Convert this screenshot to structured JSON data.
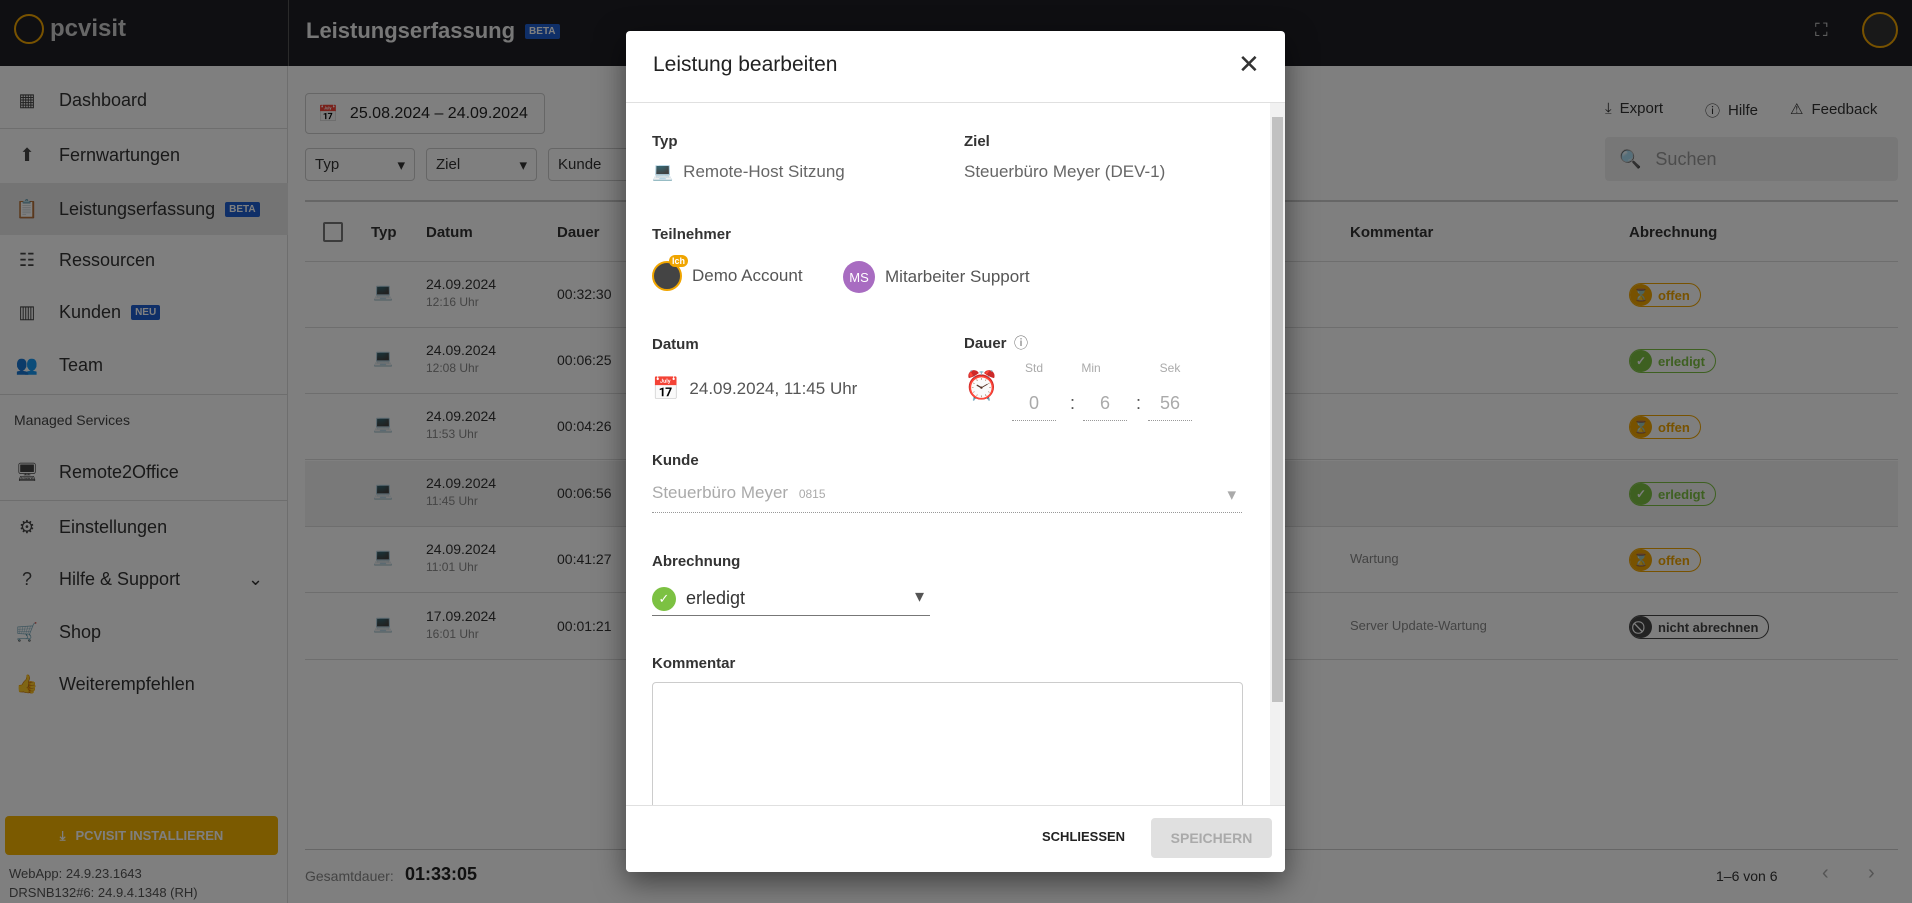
{
  "app": {
    "logo": "pcvisit",
    "title": "Leistungserfassung",
    "title_badge": "BETA"
  },
  "sidebar": {
    "items": [
      {
        "label": "Dashboard",
        "icon": "dashboard-icon"
      },
      {
        "label": "Fernwartungen",
        "icon": "remote-icon"
      },
      {
        "label": "Leistungserfassung",
        "icon": "clipboard-clock-icon",
        "badge": "BETA",
        "active": true
      },
      {
        "label": "Ressourcen",
        "icon": "tree-icon"
      },
      {
        "label": "Kunden",
        "icon": "building-icon",
        "badge": "NEU"
      },
      {
        "label": "Team",
        "icon": "people-icon"
      }
    ],
    "section": "Managed Services",
    "items2": [
      {
        "label": "Remote2Office",
        "icon": "monitor-icon"
      },
      {
        "label": "Einstellungen",
        "icon": "gear-icon"
      },
      {
        "label": "Hilfe & Support",
        "icon": "help-icon"
      },
      {
        "label": "Shop",
        "icon": "cart-icon"
      },
      {
        "label": "Weiterempfehlen",
        "icon": "thumb-up-icon"
      }
    ],
    "install_label": "PCVISIT INSTALLIEREN",
    "versions": [
      "WebApp: 24.9.23.1643",
      "DRSNB132#6: 24.9.4.1348 (RH)"
    ]
  },
  "main": {
    "date_range": "25.08.2024 – 24.09.2024",
    "filters": [
      "Typ",
      "Ziel",
      "Kunde"
    ],
    "toolbar": {
      "export": "Export",
      "help": "Hilfe",
      "feedback": "Feedback"
    },
    "search_placeholder": "Suchen",
    "columns": [
      "Typ",
      "Datum",
      "Dauer",
      "Kommentar",
      "Abrechnung"
    ],
    "rows": [
      {
        "date": "24.09.2024",
        "time": "12:16 Uhr",
        "duration": "00:32:30",
        "comment": "",
        "status": "offen"
      },
      {
        "date": "24.09.2024",
        "time": "12:08 Uhr",
        "duration": "00:06:25",
        "comment": "",
        "status": "erledigt"
      },
      {
        "date": "24.09.2024",
        "time": "11:53 Uhr",
        "duration": "00:04:26",
        "comment": "",
        "status": "offen"
      },
      {
        "date": "24.09.2024",
        "time": "11:45 Uhr",
        "duration": "00:06:56",
        "comment": "",
        "status": "erledigt"
      },
      {
        "date": "24.09.2024",
        "time": "11:01 Uhr",
        "duration": "00:41:27",
        "comment": "Wartung",
        "status": "offen"
      },
      {
        "date": "17.09.2024",
        "time": "16:01 Uhr",
        "duration": "00:01:21",
        "comment": "Server Update-Wartung",
        "status": "nicht abrechnen"
      }
    ],
    "total_label": "Gesamtdauer:",
    "total": "01:33:05",
    "pagination": "1–6 von 6"
  },
  "status_colors": {
    "offen": "#f0a500",
    "erledigt": "#7cc142",
    "nicht abrechnen": "#444444"
  },
  "modal": {
    "title": "Leistung bearbeiten",
    "typ_label": "Typ",
    "typ_value": "Remote-Host Sitzung",
    "ziel_label": "Ziel",
    "ziel_value": "Steuerbüro Meyer (DEV-1)",
    "teilnehmer_label": "Teilnehmer",
    "participants": [
      {
        "name": "Demo Account",
        "badge": "Ich"
      },
      {
        "name": "Mitarbeiter Support",
        "initials": "MS"
      }
    ],
    "datum_label": "Datum",
    "datum_value": "24.09.2024, 11:45 Uhr",
    "dauer_label": "Dauer",
    "std_label": "Std",
    "min_label": "Min",
    "sek_label": "Sek",
    "std": "0",
    "min": "6",
    "sek": "56",
    "kunde_label": "Kunde",
    "kunde_value": "Steuerbüro Meyer",
    "kunde_number": "0815",
    "abrechnung_label": "Abrechnung",
    "abrechnung_value": "erledigt",
    "kommentar_label": "Kommentar",
    "kommentar_value": "",
    "close_label": "SCHLIESSEN",
    "save_label": "SPEICHERN"
  }
}
